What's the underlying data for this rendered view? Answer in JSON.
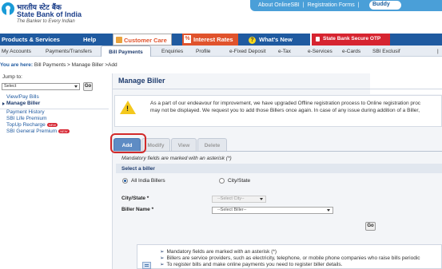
{
  "header": {
    "bank_name_hindi": "भारतीय स्टेट बैंक",
    "bank_name": "State Bank of India",
    "tagline": "The Banker to Every Indian",
    "top_links": [
      "About OnlineSBI",
      "|",
      "Registration Forms",
      "|"
    ],
    "buddy_label": "Buddy"
  },
  "main_nav": {
    "items": [
      {
        "label": "Products & Services"
      },
      {
        "label": "Help"
      },
      {
        "label": "Customer Care"
      },
      {
        "label": "Interest Rates"
      },
      {
        "label": "What's New"
      },
      {
        "label": "State Bank Secure OTP"
      }
    ],
    "pct_glyph": "%",
    "help_glyph": "?"
  },
  "sub_nav": {
    "items": [
      "My Accounts",
      "Payments/Transfers",
      "Bill Payments",
      "Enquiries",
      "Profile",
      "e-Fixed Deposit",
      "e-Tax",
      "e-Services",
      "e-Cards",
      "SBI Exclusif",
      "|"
    ],
    "active": "Bill Payments"
  },
  "breadcrumb": {
    "prefix": "You are here:",
    "path": "Bill Payments > Manage Biller >Add"
  },
  "sidebar": {
    "jump_label": "Jump to:",
    "jump_select_value": "Select",
    "go_label": "Go",
    "items": [
      {
        "label": "View/Pay Bills"
      },
      {
        "label": "Manage Biller"
      },
      {
        "label": "Payment History"
      },
      {
        "label": "SBI Life Premium"
      },
      {
        "label": "TopUp Recharge"
      },
      {
        "label": "SBI General Premium"
      }
    ],
    "new_badge": "NEW"
  },
  "main": {
    "title": "Manage Biller",
    "notice_lines": [
      "As a part of our endeavour for improvement, we have upgraded Offline registration process to Online registration proc",
      "may not be displayed. We request you to add those Billers once again. In case of any issue during addition of a Biller,"
    ],
    "notice_icon_glyph": "!",
    "tabs": [
      {
        "label": "Add"
      },
      {
        "label": "Modify"
      },
      {
        "label": "View"
      },
      {
        "label": "Delete"
      }
    ],
    "active_tab": "Add",
    "mandatory_note": "Mandatory fields are marked with an asterisk (*)",
    "select_biller_heading": "Select a biller",
    "radio_options": [
      {
        "label": "All India Billers",
        "checked": true
      },
      {
        "label": "City/State",
        "checked": false
      }
    ],
    "city_label": "City/State *",
    "city_placeholder": "--Select City--",
    "biller_label": "Biller Name *",
    "biller_placeholder": "--Select Biller--",
    "go_label": "Go",
    "info_bullet_glyph": "➢",
    "info_lines": [
      "Mandatory fields are marked with an asterisk (*)",
      "Billers are service providers, such as electricity, telephone, or mobile phone companies who raise bills periodic",
      "To register bills and make online payments you need to register biller details."
    ]
  },
  "colors": {
    "brand_blue": "#1f5aa0",
    "accent_orange": "#e0532c",
    "otp_red": "#d62430",
    "highlight_red": "#d22a2a",
    "active_tab": "#5e8cc4"
  }
}
